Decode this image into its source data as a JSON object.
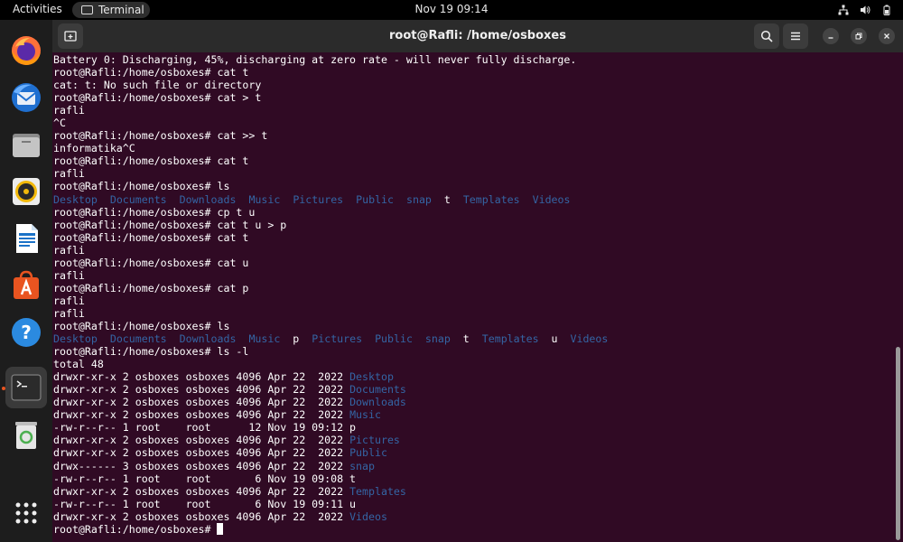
{
  "topbar": {
    "activities": "Activities",
    "app_name": "Terminal",
    "clock": "Nov 19  09:14"
  },
  "dock": {
    "items": [
      {
        "name": "firefox",
        "icon": "firefox-icon"
      },
      {
        "name": "thunderbird",
        "icon": "thunderbird-icon"
      },
      {
        "name": "files",
        "icon": "files-icon"
      },
      {
        "name": "rhythmbox",
        "icon": "rhythmbox-icon"
      },
      {
        "name": "writer",
        "icon": "libreoffice-writer-icon"
      },
      {
        "name": "software",
        "icon": "app-center-icon"
      },
      {
        "name": "help",
        "icon": "help-icon"
      },
      {
        "name": "terminal",
        "icon": "terminal-icon"
      },
      {
        "name": "trash",
        "icon": "trash-icon"
      },
      {
        "name": "show-apps",
        "icon": "app-grid-icon"
      }
    ]
  },
  "window": {
    "title": "root@Rafli: /home/osboxes"
  },
  "colors": {
    "terminal_bg": "#300a24",
    "dir_blue": "#3465a4",
    "accent": "#e95420"
  },
  "terminal": {
    "lines": [
      [
        {
          "t": "Battery 0: Discharging, 45%, discharging at zero rate - will never fully discharge."
        }
      ],
      [
        {
          "t": "root@Rafli:/home/osboxes# cat t"
        }
      ],
      [
        {
          "t": "cat: t: No such file or directory"
        }
      ],
      [
        {
          "t": "root@Rafli:/home/osboxes# cat > t"
        }
      ],
      [
        {
          "t": "rafli"
        }
      ],
      [
        {
          "t": "^C"
        }
      ],
      [
        {
          "t": "root@Rafli:/home/osboxes# cat >> t"
        }
      ],
      [
        {
          "t": "informatika^C"
        }
      ],
      [
        {
          "t": "root@Rafli:/home/osboxes# cat t"
        }
      ],
      [
        {
          "t": "rafli"
        }
      ],
      [
        {
          "t": "root@Rafli:/home/osboxes# ls"
        }
      ],
      [
        {
          "t": "Desktop",
          "c": "dir"
        },
        {
          "t": "  "
        },
        {
          "t": "Documents",
          "c": "dir"
        },
        {
          "t": "  "
        },
        {
          "t": "Downloads",
          "c": "dir"
        },
        {
          "t": "  "
        },
        {
          "t": "Music",
          "c": "dir"
        },
        {
          "t": "  "
        },
        {
          "t": "Pictures",
          "c": "dir"
        },
        {
          "t": "  "
        },
        {
          "t": "Public",
          "c": "dir"
        },
        {
          "t": "  "
        },
        {
          "t": "snap",
          "c": "dir"
        },
        {
          "t": "  t  "
        },
        {
          "t": "Templates",
          "c": "dir"
        },
        {
          "t": "  "
        },
        {
          "t": "Videos",
          "c": "dir"
        }
      ],
      [
        {
          "t": "root@Rafli:/home/osboxes# cp t u"
        }
      ],
      [
        {
          "t": "root@Rafli:/home/osboxes# cat t u > p"
        }
      ],
      [
        {
          "t": "root@Rafli:/home/osboxes# cat t"
        }
      ],
      [
        {
          "t": "rafli"
        }
      ],
      [
        {
          "t": "root@Rafli:/home/osboxes# cat u"
        }
      ],
      [
        {
          "t": "rafli"
        }
      ],
      [
        {
          "t": "root@Rafli:/home/osboxes# cat p"
        }
      ],
      [
        {
          "t": "rafli"
        }
      ],
      [
        {
          "t": "rafli"
        }
      ],
      [
        {
          "t": "root@Rafli:/home/osboxes# ls"
        }
      ],
      [
        {
          "t": "Desktop",
          "c": "dir"
        },
        {
          "t": "  "
        },
        {
          "t": "Documents",
          "c": "dir"
        },
        {
          "t": "  "
        },
        {
          "t": "Downloads",
          "c": "dir"
        },
        {
          "t": "  "
        },
        {
          "t": "Music",
          "c": "dir"
        },
        {
          "t": "  p  "
        },
        {
          "t": "Pictures",
          "c": "dir"
        },
        {
          "t": "  "
        },
        {
          "t": "Public",
          "c": "dir"
        },
        {
          "t": "  "
        },
        {
          "t": "snap",
          "c": "dir"
        },
        {
          "t": "  t  "
        },
        {
          "t": "Templates",
          "c": "dir"
        },
        {
          "t": "  u  "
        },
        {
          "t": "Videos",
          "c": "dir"
        }
      ],
      [
        {
          "t": "root@Rafli:/home/osboxes# ls -l"
        }
      ],
      [
        {
          "t": "total 48"
        }
      ],
      [
        {
          "t": "drwxr-xr-x 2 osboxes osboxes 4096 Apr 22  2022 "
        },
        {
          "t": "Desktop",
          "c": "dir"
        }
      ],
      [
        {
          "t": "drwxr-xr-x 2 osboxes osboxes 4096 Apr 22  2022 "
        },
        {
          "t": "Documents",
          "c": "dir"
        }
      ],
      [
        {
          "t": "drwxr-xr-x 2 osboxes osboxes 4096 Apr 22  2022 "
        },
        {
          "t": "Downloads",
          "c": "dir"
        }
      ],
      [
        {
          "t": "drwxr-xr-x 2 osboxes osboxes 4096 Apr 22  2022 "
        },
        {
          "t": "Music",
          "c": "dir"
        }
      ],
      [
        {
          "t": "-rw-r--r-- 1 root    root      12 Nov 19 09:12 p"
        }
      ],
      [
        {
          "t": "drwxr-xr-x 2 osboxes osboxes 4096 Apr 22  2022 "
        },
        {
          "t": "Pictures",
          "c": "dir"
        }
      ],
      [
        {
          "t": "drwxr-xr-x 2 osboxes osboxes 4096 Apr 22  2022 "
        },
        {
          "t": "Public",
          "c": "dir"
        }
      ],
      [
        {
          "t": "drwx------ 3 osboxes osboxes 4096 Apr 22  2022 "
        },
        {
          "t": "snap",
          "c": "dir"
        }
      ],
      [
        {
          "t": "-rw-r--r-- 1 root    root       6 Nov 19 09:08 t"
        }
      ],
      [
        {
          "t": "drwxr-xr-x 2 osboxes osboxes 4096 Apr 22  2022 "
        },
        {
          "t": "Templates",
          "c": "dir"
        }
      ],
      [
        {
          "t": "-rw-r--r-- 1 root    root       6 Nov 19 09:11 u"
        }
      ],
      [
        {
          "t": "drwxr-xr-x 2 osboxes osboxes 4096 Apr 22  2022 "
        },
        {
          "t": "Videos",
          "c": "dir"
        }
      ],
      [
        {
          "t": "root@Rafli:/home/osboxes# "
        },
        {
          "cursor": true
        }
      ]
    ]
  }
}
